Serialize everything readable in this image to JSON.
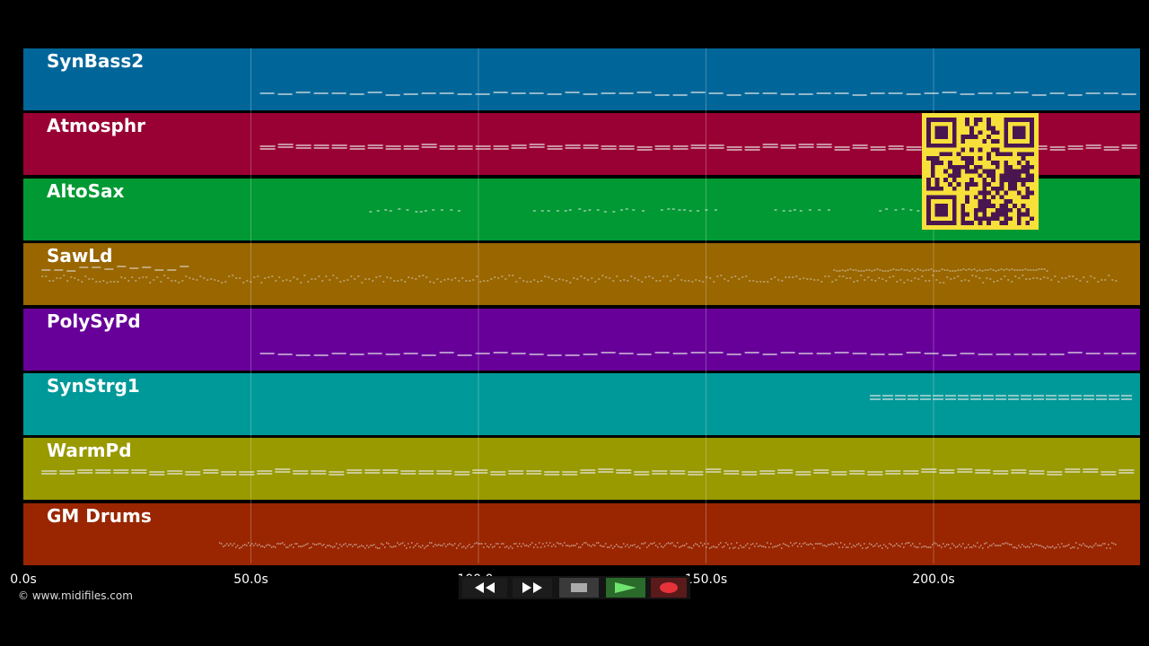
{
  "timeline": {
    "duration_s": 243,
    "ticks": [
      "0.0s",
      "50.0s",
      "100.0s",
      "150.0s",
      "200.0s"
    ],
    "tick_values": [
      0,
      50,
      100,
      150,
      200
    ]
  },
  "tracks": [
    {
      "name": "SynBass2",
      "color": "#006699",
      "pattern": "bass",
      "start": 52,
      "end": 243
    },
    {
      "name": "Atmosphr",
      "color": "#990033",
      "pattern": "double",
      "start": 52,
      "end": 243
    },
    {
      "name": "AltoSax",
      "color": "#009933",
      "pattern": "sparse",
      "start": 76,
      "end": 178
    },
    {
      "name": "SawLd",
      "color": "#996600",
      "pattern": "lead",
      "start": 4,
      "end": 240
    },
    {
      "name": "PolySyPd",
      "color": "#660099",
      "pattern": "bass",
      "start": 52,
      "end": 243
    },
    {
      "name": "SynStrg1",
      "color": "#009999",
      "pattern": "strings",
      "start": 186,
      "end": 243
    },
    {
      "name": "WarmPd",
      "color": "#999900",
      "pattern": "double",
      "start": 4,
      "end": 243
    },
    {
      "name": "GM Drums",
      "color": "#992600",
      "pattern": "drums",
      "start": 43,
      "end": 240
    }
  ],
  "copyright": "© www.midifiles.com",
  "qr_code": {
    "label": "qr-code",
    "fg": "#4a1650",
    "bg": "#f7e03a"
  },
  "transport": {
    "buttons": [
      {
        "name": "rewind-button",
        "icon": "rewind-icon"
      },
      {
        "name": "fast-forward-button",
        "icon": "fast-forward-icon"
      },
      {
        "name": "stop-button",
        "icon": "stop-icon"
      },
      {
        "name": "play-button",
        "icon": "play-icon"
      },
      {
        "name": "record-button",
        "icon": "record-icon"
      }
    ]
  }
}
